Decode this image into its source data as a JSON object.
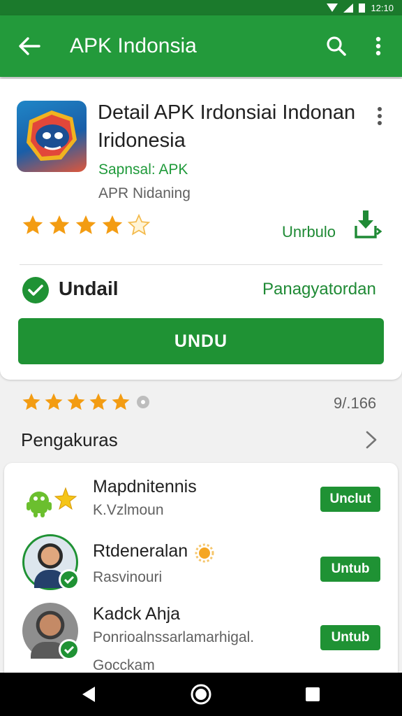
{
  "status_bar": {
    "time": "12:10"
  },
  "app_bar": {
    "title": "APK Indonsia",
    "back_icon": "arrow-back-icon",
    "search_icon": "search-icon",
    "more_icon": "more-vert-icon"
  },
  "app": {
    "title": "Detail APK Irdonsiai Indonan Iridonesia",
    "developer": "Sapnsal: APK",
    "category": "APR Nidaning",
    "rating_stars": 4.5,
    "install_link": "Unrbulo",
    "verified_label": "Undail",
    "verified_link": "Panagyatordan",
    "main_button": "UNDU"
  },
  "ratings": {
    "stars": 5,
    "count": "9/.166"
  },
  "section": {
    "title": "Pengakuras"
  },
  "list": [
    {
      "name": "Mapdnitennis",
      "sub": "K.Vzlmoun",
      "button": "Unclut"
    },
    {
      "name": "Rtdeneralan",
      "sub": "Rasvinouri",
      "button": "Untub"
    },
    {
      "name": "Kadck Ahja",
      "sub": "Ponrioalnssarlamarhigal.",
      "sub2": "Gocckam",
      "button": "Untub"
    }
  ],
  "colors": {
    "primary": "#239a3b",
    "status": "#1b7a2c",
    "button": "#1f9234",
    "star": "#f39c12"
  }
}
